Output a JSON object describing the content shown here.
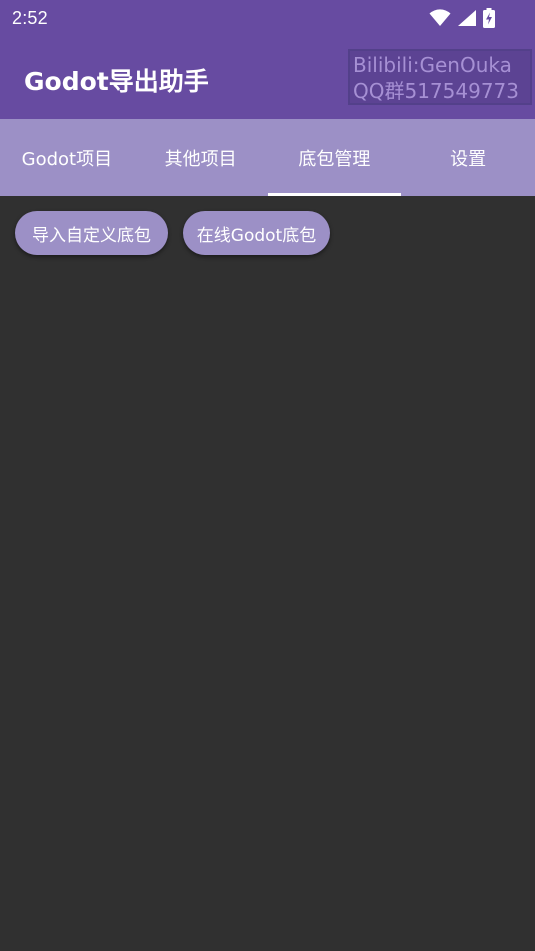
{
  "status_bar": {
    "time": "2:52",
    "icons": [
      "wifi-icon",
      "cell-signal-icon",
      "battery-charging-icon"
    ]
  },
  "app_bar": {
    "title": "Godot导出助手",
    "watermark_line1": "Bilibili:GenOuka",
    "watermark_line2": "QQ群517549773"
  },
  "tabs": [
    {
      "label": "Godot项目",
      "active": false
    },
    {
      "label": "其他项目",
      "active": false
    },
    {
      "label": "底包管理",
      "active": true
    },
    {
      "label": "设置",
      "active": false
    }
  ],
  "actions": {
    "import_custom_label": "导入自定义底包",
    "online_godot_label": "在线Godot底包"
  },
  "colors": {
    "primary": "#674ba1",
    "tab_bar": "#9c90c6",
    "chip": "#9c90c6",
    "background": "#303030",
    "text": "#ffffff"
  }
}
